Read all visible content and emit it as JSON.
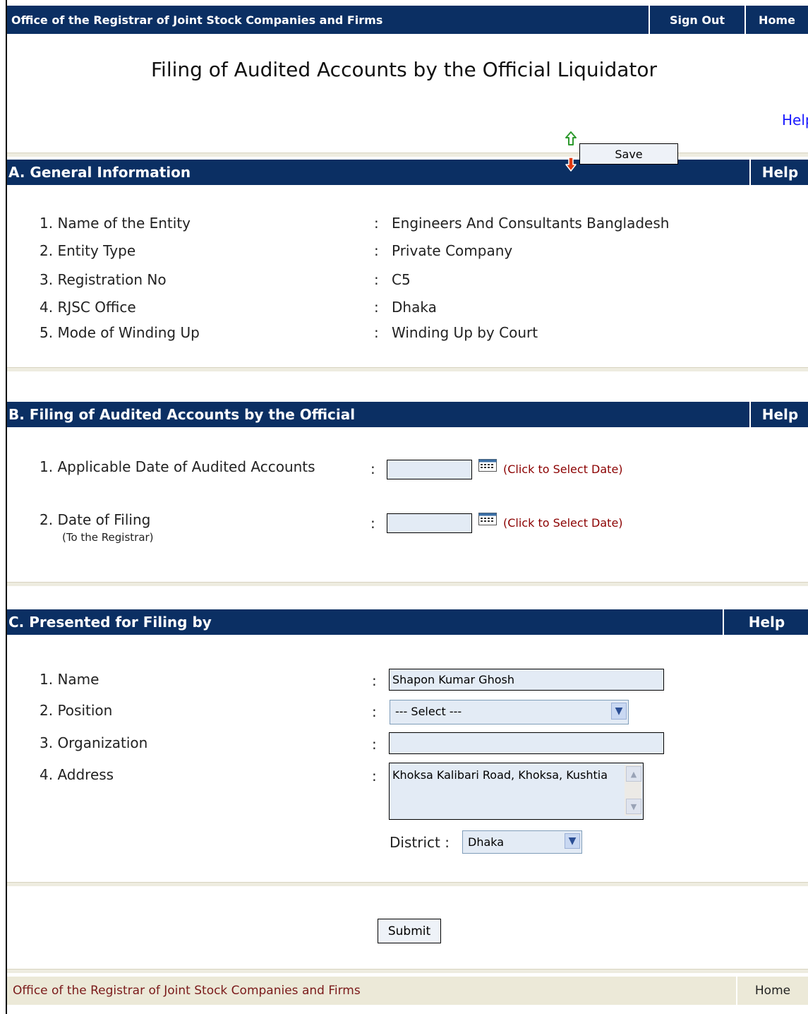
{
  "topbar": {
    "title": "Office of the Registrar of Joint Stock Companies and Firms",
    "sign_out": "Sign Out",
    "home": "Home"
  },
  "page": {
    "title": "Filing of Audited Accounts by the Official Liquidator",
    "help_link": "Help",
    "save_label": "Save"
  },
  "section_a": {
    "title": "A. General Information",
    "help": "Help",
    "colon": ":",
    "rows": [
      {
        "label": "1. Name of the Entity",
        "value": "Engineers And Consultants Bangladesh"
      },
      {
        "label": "2. Entity Type",
        "value": "Private Company"
      },
      {
        "label": "3. Registration No",
        "value": "C5"
      },
      {
        "label": "4. RJSC Office",
        "value": "Dhaka"
      },
      {
        "label": "5. Mode of Winding Up",
        "value": "Winding Up by Court"
      }
    ]
  },
  "section_b": {
    "title": "B. Filing of Audited Accounts by the Official",
    "help": "Help",
    "colon": ":",
    "applicable_date": {
      "label": "1. Applicable Date of Audited Accounts",
      "value": "",
      "note": "(Click to Select Date)"
    },
    "filing_date": {
      "label": "2. Date of Filing",
      "sublabel": "(To the Registrar)",
      "value": "",
      "note": "(Click to Select Date)"
    }
  },
  "section_c": {
    "title": "C. Presented for Filing by",
    "help": "Help",
    "colon": ":",
    "name": {
      "label": "1. Name",
      "value": "Shapon Kumar Ghosh"
    },
    "position": {
      "label": "2. Position",
      "selected": "--- Select ---"
    },
    "organization": {
      "label": "3. Organization",
      "value": ""
    },
    "address": {
      "label": "4. Address",
      "value": "Khoksa Kalibari Road, Khoksa, Kushtia"
    },
    "district": {
      "label": "District :",
      "selected": "Dhaka"
    }
  },
  "submit_label": "Submit",
  "footer": {
    "title": "Office of the Registrar of Joint Stock Companies and Firms",
    "home": "Home"
  },
  "colors": {
    "navy": "#0b2f63",
    "field_bg": "#e3ebf5",
    "footer_bg": "#ece9d8",
    "note_red": "#8b0000"
  }
}
